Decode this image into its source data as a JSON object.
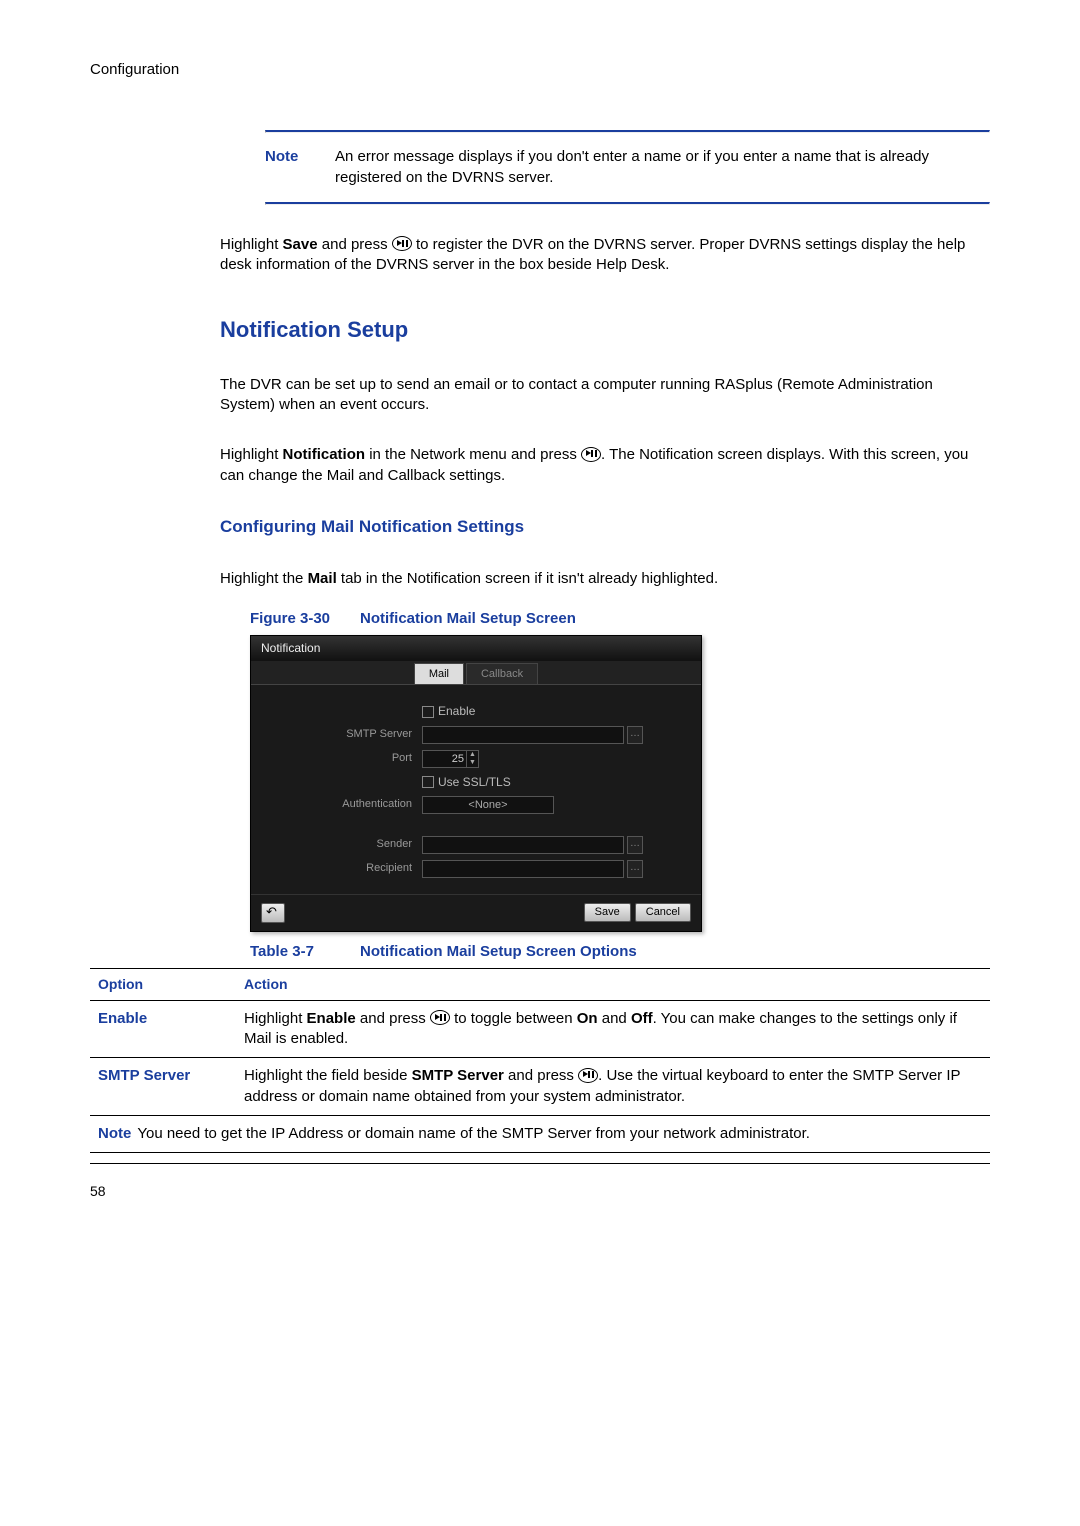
{
  "header": {
    "section": "Configuration"
  },
  "noteBox": {
    "label": "Note",
    "text": "An error message displays if you don't enter a name or if you enter a name that is already registered on the DVRNS server."
  },
  "para_save": {
    "pre": "Highlight ",
    "bold1": "Save",
    "mid": " and press ",
    "post": " to register the DVR on the DVRNS server. Proper DVRNS settings display the help desk information of the DVRNS server in the box beside Help Desk."
  },
  "h2": "Notification Setup",
  "para_intro": "The DVR can be set up to send an email or to contact a computer running RASplus (Remote Administration System) when an event occurs.",
  "para_notif": {
    "pre": "Highlight ",
    "bold1": "Notification",
    "mid": " in the Network menu and press ",
    "post": ". The Notification screen displays. With this screen, you can change the Mail and Callback settings."
  },
  "h3": "Configuring Mail Notification Settings",
  "para_mailtab": {
    "pre": "Highlight the ",
    "bold1": "Mail",
    "post": " tab in the Notification screen if it isn't already highlighted."
  },
  "figure": {
    "num": "Figure 3-30",
    "title": "Notification Mail Setup Screen"
  },
  "mock": {
    "title": "Notification",
    "tab_mail": "Mail",
    "tab_callback": "Callback",
    "enable": "Enable",
    "smtp": "SMTP Server",
    "port": "Port",
    "port_val": "25",
    "ssl": "Use SSL/TLS",
    "auth": "Authentication",
    "auth_val": "<None>",
    "sender": "Sender",
    "recipient": "Recipient",
    "save": "Save",
    "cancel": "Cancel"
  },
  "table": {
    "num": "Table 3-7",
    "title": "Notification Mail Setup Screen Options"
  },
  "thead": {
    "option": "Option",
    "action": "Action"
  },
  "rows": {
    "enable": {
      "label": "Enable",
      "pre": "Highlight ",
      "b1": "Enable",
      "mid": " and press ",
      "mid2": " to toggle between ",
      "b2": "On",
      "and": " and ",
      "b3": "Off",
      "post": ". You can make changes to the settings only if Mail is enabled."
    },
    "smtp": {
      "label": "SMTP Server",
      "pre": "Highlight the field beside ",
      "b1": "SMTP Server",
      "mid": " and press ",
      "post": ". Use the virtual keyboard to enter the SMTP Server IP address or domain name obtained from your system administrator."
    },
    "note": {
      "label": "Note",
      "text": "You need to get the IP Address or domain name of the SMTP Server from your network administrator."
    }
  },
  "page": "58"
}
